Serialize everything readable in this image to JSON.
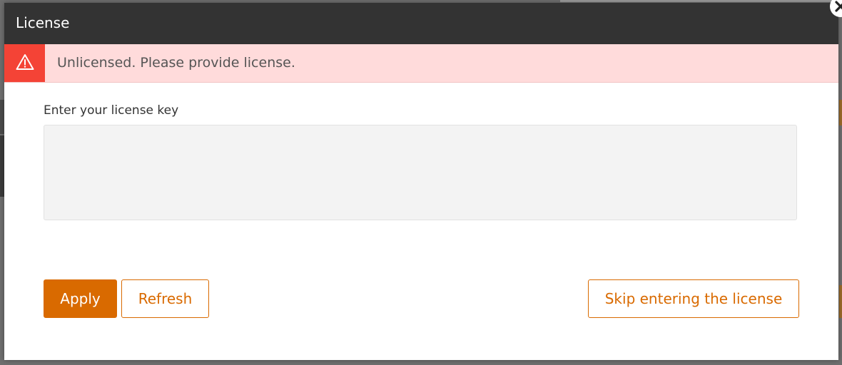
{
  "modal": {
    "title": "License",
    "close_icon": "close-icon"
  },
  "alert": {
    "icon": "warning-icon",
    "message": "Unlicensed. Please provide license.",
    "colors": {
      "icon_background": "#f44336",
      "background": "#ffdbdb"
    }
  },
  "form": {
    "license_label": "Enter your license key",
    "license_value": "",
    "license_placeholder": ""
  },
  "actions": {
    "apply_label": "Apply",
    "refresh_label": "Refresh",
    "skip_label": "Skip entering the license"
  },
  "colors": {
    "header_background": "#333333",
    "accent": "#d96a00"
  }
}
